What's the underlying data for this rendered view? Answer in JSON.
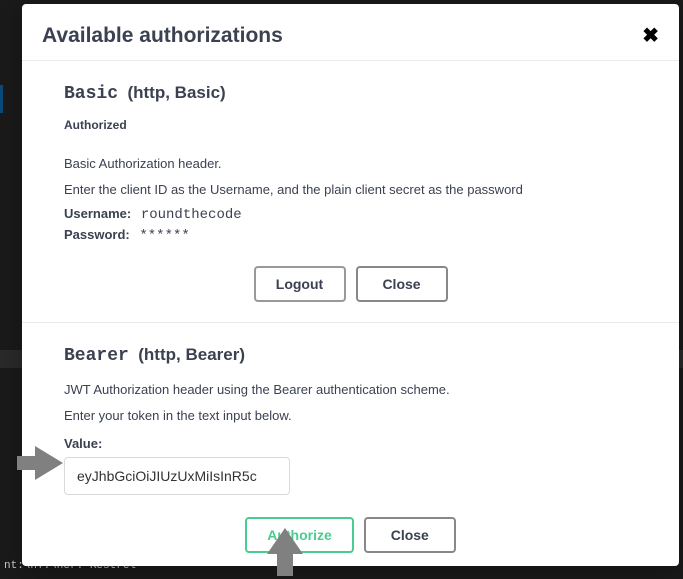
{
  "header": {
    "title": "Available authorizations",
    "close_icon_glyph": "✖"
  },
  "basic": {
    "scheme_name": "Basic",
    "scheme_meta": "(http, Basic)",
    "authorized_label": "Authorized",
    "description_line1": "Basic Authorization header.",
    "description_line2": "Enter the client ID as the Username, and the plain client secret as the password",
    "username_key": "Username:",
    "username_value": "roundthecode",
    "password_key": "Password:",
    "password_value": "******",
    "logout_label": "Logout",
    "close_label": "Close"
  },
  "bearer": {
    "scheme_name": "Bearer",
    "scheme_meta": "(http, Bearer)",
    "description_line1": "JWT Authorization header using the Bearer authentication scheme.",
    "description_line2": "Enter your token in the text input below.",
    "value_label": "Value:",
    "token_value": "eyJhbGciOiJIUzUxMiIsInR5c",
    "authorize_label": "Authorize",
    "close_label": "Close"
  },
  "noise": {
    "bg_text": "nt:\\nT:\\ner: Kestrel"
  }
}
